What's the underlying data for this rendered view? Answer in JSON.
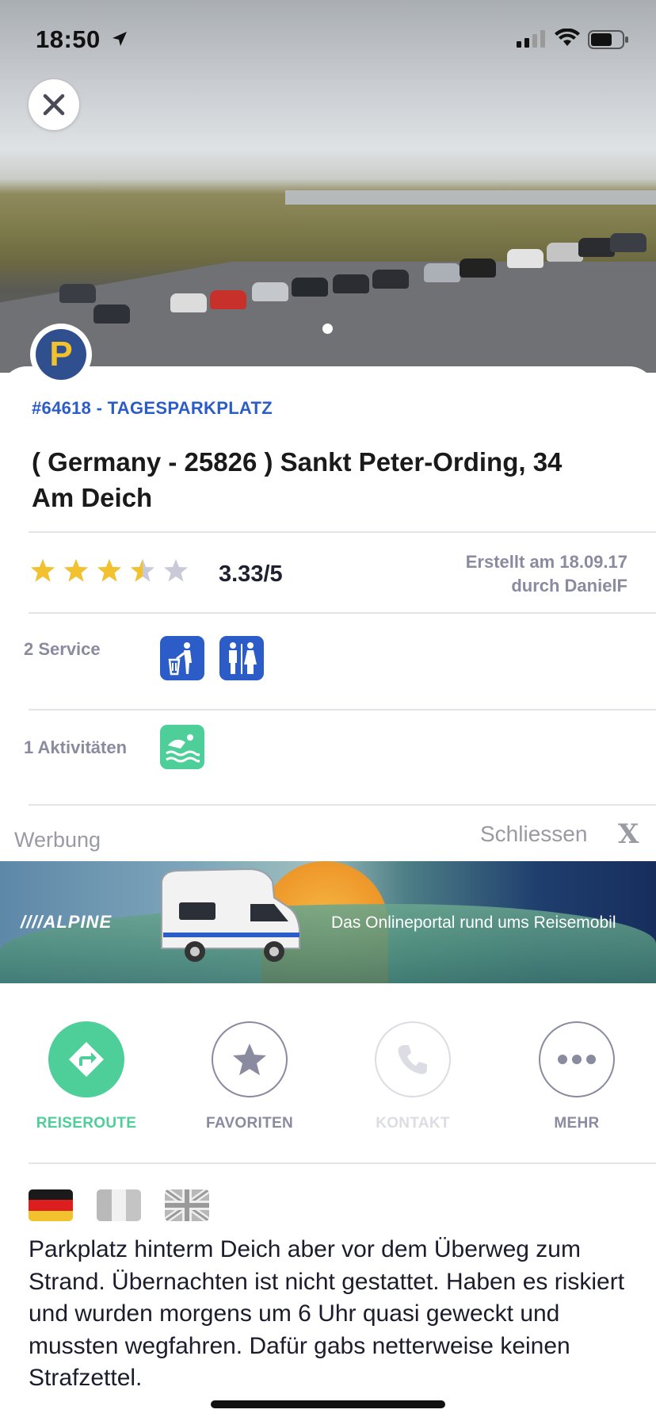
{
  "status_bar": {
    "time": "18:50"
  },
  "place": {
    "ref": "#64618 - TAGESPARKPLATZ",
    "title": "( Germany - 25826 ) Sankt Peter-Ording, 34 Am Deich",
    "badge_letter": "P",
    "rating_value": 3.33,
    "rating_text": "3.33/5",
    "created_line1": "Erstellt am 18.09.17",
    "created_line2": "durch DanielF"
  },
  "service": {
    "label": "2 Service",
    "icons": [
      "trash-bin-icon",
      "restroom-icon"
    ]
  },
  "activities": {
    "label": "1 Aktivitäten",
    "icons": [
      "swimming-icon"
    ]
  },
  "ad": {
    "werbung": "Werbung",
    "close_label": "Schliessen",
    "close_x": "X",
    "brand": "////ALPINE",
    "tagline": "Das Onlineportal rund ums Reisemobil"
  },
  "actions": [
    {
      "label": "REISEROUTE",
      "icon": "directions-icon",
      "color": "#4ecf9a"
    },
    {
      "label": "FAVORITEN",
      "icon": "star-icon",
      "color": "#8a8aa0"
    },
    {
      "label": "KONTAKT",
      "icon": "phone-icon",
      "color": "#dcdce4"
    },
    {
      "label": "MEHR",
      "icon": "more-icon",
      "color": "#8a8aa0"
    }
  ],
  "languages": [
    "german-flag-icon",
    "french-flag-icon",
    "uk-flag-icon"
  ],
  "description": "Parkplatz hinterm Deich aber vor dem Überweg zum Strand. Übernachten ist nicht gestattet. Haben es riskiert und wurden morgens um 6 Uhr quasi geweckt und mussten wegfahren. Dafür gabs netterweise keinen Strafzettel.",
  "colors": {
    "accent_blue": "#2b5cc7",
    "star": "#f2c12e",
    "star_empty": "#c8cad8",
    "muted": "#8a8aa0"
  }
}
